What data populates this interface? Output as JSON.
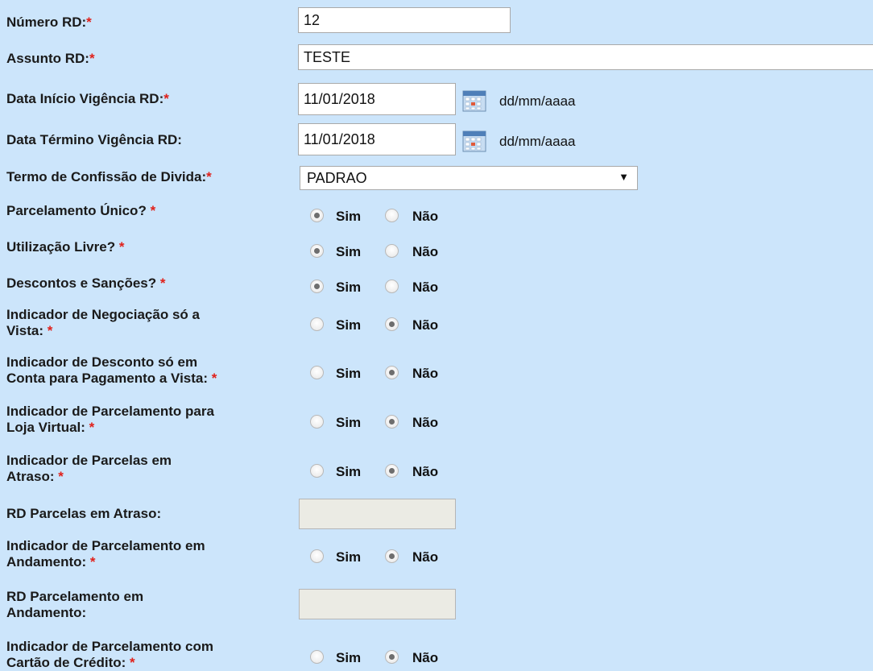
{
  "required_mark": "*",
  "fields": {
    "numero": {
      "label": "Número RD:",
      "value": "12"
    },
    "assunto": {
      "label": "Assunto RD:",
      "value": "TESTE"
    },
    "data_inicio": {
      "label": "Data Início Vigência RD:",
      "value": "11/01/2018",
      "format": "dd/mm/aaaa"
    },
    "data_termino": {
      "label": "Data Término Vigência RD:",
      "value": "11/01/2018",
      "format": "dd/mm/aaaa"
    },
    "termo": {
      "label": "Termo de Confissão de Divida:",
      "selected": "PADRAO",
      "arrow": "▼"
    },
    "rd_parcelas_atraso": {
      "label": "RD Parcelas em Atraso:",
      "value": ""
    },
    "rd_parcelamento_andamento": {
      "label_line1": "RD Parcelamento em",
      "label_line2": "Andamento:",
      "value": ""
    }
  },
  "radio_text": {
    "sim": "Sim",
    "nao": "Não"
  },
  "radios": [
    {
      "line1": "Parcelamento Único?",
      "line2": "",
      "selected": "sim"
    },
    {
      "line1": "Utilização Livre?",
      "line2": "",
      "selected": "sim"
    },
    {
      "line1": "Descontos e Sanções?",
      "line2": "",
      "selected": "sim"
    },
    {
      "line1": "Indicador de Negociação só a",
      "line2": "Vista:",
      "selected": "nao"
    },
    {
      "line1": "Indicador de Desconto só em",
      "line2": "Conta para Pagamento a Vista:",
      "selected": "nao"
    },
    {
      "line1": "Indicador de Parcelamento para",
      "line2": "Loja Virtual:",
      "selected": "nao"
    },
    {
      "line1": "Indicador de Parcelas em",
      "line2": "Atraso:",
      "selected": "nao"
    },
    {
      "line1": "Indicador de Parcelamento em",
      "line2": "Andamento:",
      "selected": "nao"
    },
    {
      "line1": "Indicador de Parcelamento com",
      "line2": "Cartão de Crédito:",
      "selected": "nao"
    }
  ],
  "colors": {
    "background": "#cce5fb",
    "required": "#e0201a"
  },
  "icons": {
    "calendar": "calendar-icon",
    "dropdown": "chevron-down-icon"
  }
}
